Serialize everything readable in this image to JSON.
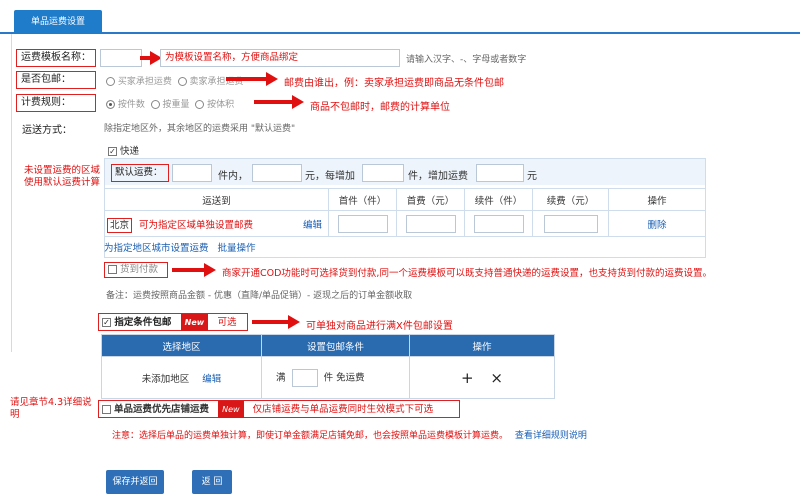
{
  "tab": {
    "label": "单品运费设置"
  },
  "template_name": {
    "label": "运费模板名称：",
    "value": "为模板设置名称，方便商品绑定",
    "hint": "请输入汉字、-、字母或者数字"
  },
  "free_shipping": {
    "label": "是否包邮：",
    "option1": "买家承担运费",
    "option2": "卖家承担运费",
    "note": "邮费由谁出，例：卖家承担运费即商品无条件包邮"
  },
  "pricing_rule": {
    "label": "计费规则：",
    "option1": "按件数",
    "option2": "按重量",
    "option3": "按体积",
    "note": "商品不包邮时，邮费的计算单位"
  },
  "delivery_method": {
    "label": "运送方式：",
    "hint": "除指定地区外，其余地区的运费采用 \"默认运费\""
  },
  "left_note_default": "未设置运费的区域使用默认运费计算",
  "express": {
    "label": "快递"
  },
  "default_freight": {
    "label": "默认运费：",
    "t1": "件内，",
    "t2": "元，每增加",
    "t3": "件，增加运费",
    "t4": "元"
  },
  "region_table": {
    "headers": [
      "运送到",
      "首件（件）",
      "首费（元）",
      "续件（件）",
      "续费（元）",
      "操作"
    ],
    "row": {
      "region": "北京",
      "note": "可为指定区域单独设置邮费",
      "edit": "编辑",
      "delete": "删除"
    },
    "add_link": "为指定地区城市设置运费",
    "batch_link": "批量操作"
  },
  "cod": {
    "label": "货到付款",
    "note": "商家开通COD功能时可选择货到付款,同一个运费模板可以既支持普通快递的运费设置，也支持货到付款的运费设置。"
  },
  "remark": "备注：运费按照商品金额 - 优惠（直降/单品促销）- 返现之后的订单金额收取",
  "conditional_free": {
    "label": "指定条件包邮",
    "badge": "New",
    "optional": "可选",
    "note": "可单独对商品进行满X件包邮设置"
  },
  "condition_table": {
    "headers": [
      "选择地区",
      "设置包邮条件",
      "操作"
    ],
    "row": {
      "region": "未添加地区",
      "edit": "编辑",
      "prefix": "满",
      "suffix": "件 免运费",
      "add": "+",
      "remove": "×"
    }
  },
  "priority_note_left": "请见章节4.3详细说明",
  "priority": {
    "label": "单品运费优先店铺运费",
    "badge": "New",
    "note": "仅店铺运费与单品运费同时生效模式下可选"
  },
  "notice": {
    "text": "注意：选择后单品的运费单独计算，即使订单金额满足店铺免邮，也会按照单品运费模板计算运费。",
    "link": "查看详细规则说明"
  },
  "buttons": {
    "save": "保存并返回",
    "back": "返 回"
  }
}
